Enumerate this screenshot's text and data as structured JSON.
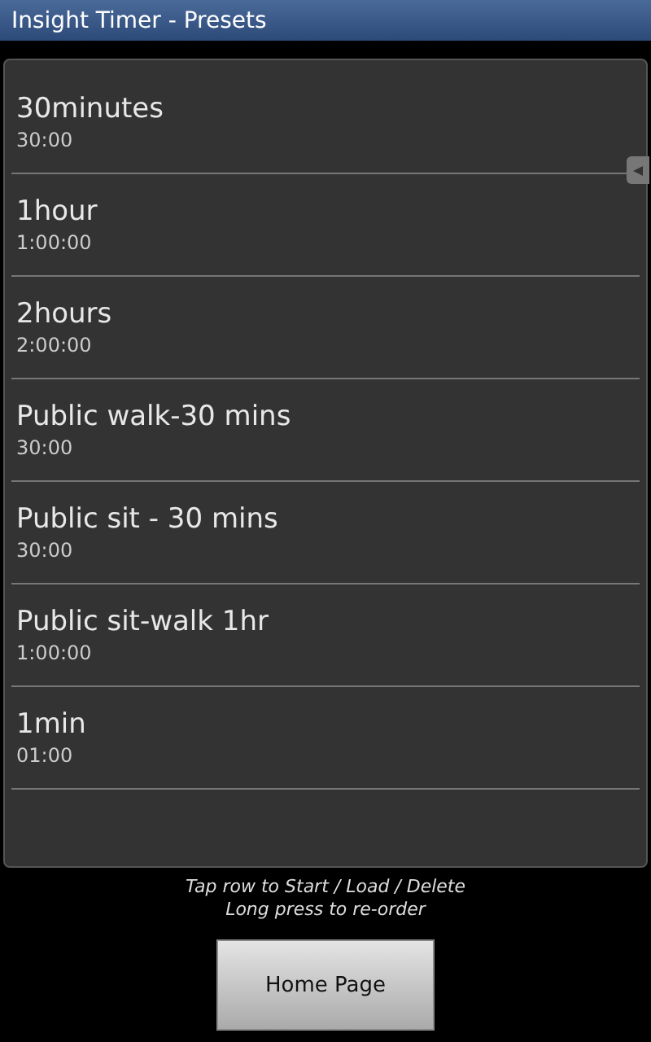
{
  "window": {
    "title": "Insight Timer - Presets"
  },
  "presets": [
    {
      "name": "30minutes",
      "duration": "30:00"
    },
    {
      "name": "1hour",
      "duration": "1:00:00"
    },
    {
      "name": "2hours",
      "duration": "2:00:00"
    },
    {
      "name": "Public walk-30 mins",
      "duration": "30:00"
    },
    {
      "name": "Public sit - 30 mins",
      "duration": "30:00"
    },
    {
      "name": "Public sit-walk 1hr",
      "duration": "1:00:00"
    },
    {
      "name": "1min",
      "duration": "01:00"
    }
  ],
  "hint_lines": [
    "Tap row to Start / Load / Delete",
    "Long press to re-order"
  ],
  "buttons": [
    "Home Page"
  ]
}
